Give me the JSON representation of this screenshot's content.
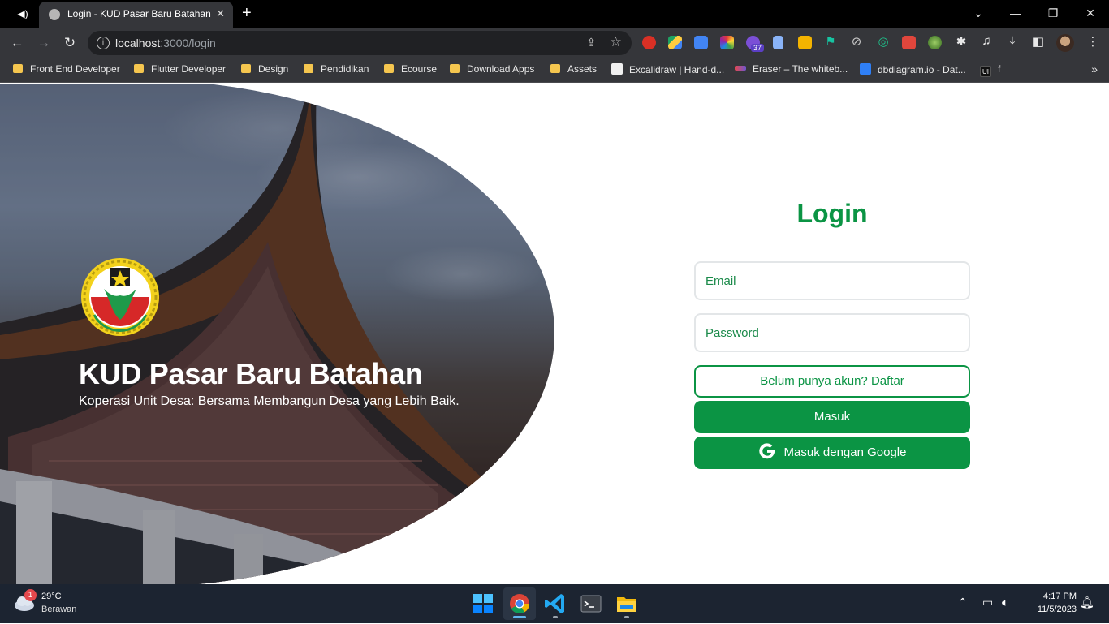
{
  "browser": {
    "tab_title": "Login - KUD Pasar Baru Batahan",
    "url_host": "localhost",
    "url_path": ":3000/login",
    "extension_badge": "37",
    "bookmarks": [
      {
        "label": "Front End Developer",
        "type": "folder"
      },
      {
        "label": "Flutter Developer",
        "type": "folder"
      },
      {
        "label": "Design",
        "type": "folder"
      },
      {
        "label": "Pendidikan",
        "type": "folder"
      },
      {
        "label": "Ecourse",
        "type": "folder"
      },
      {
        "label": "Download Apps",
        "type": "folder"
      },
      {
        "label": "Assets",
        "type": "folder"
      },
      {
        "label": "Excalidraw | Hand-d...",
        "type": "site"
      },
      {
        "label": "Eraser – The whiteb...",
        "type": "site"
      },
      {
        "label": "dbdiagram.io - Dat...",
        "type": "site"
      },
      {
        "label": "f",
        "type": "site"
      }
    ],
    "bookmark_ui_icon_text": "UI"
  },
  "hero": {
    "title": "KUD Pasar Baru Batahan",
    "subtitle": "Koperasi Unit Desa: Bersama Membangun Desa yang Lebih Baik.",
    "logo_caption": "KOPERASI INDONESIA"
  },
  "login": {
    "title": "Login",
    "email_placeholder": "Email",
    "password_placeholder": "Password",
    "register_label": "Belum punya akun? Daftar",
    "submit_label": "Masuk",
    "google_label": "Masuk dengan Google"
  },
  "taskbar": {
    "weather_badge": "1",
    "temperature": "29°C",
    "weather_desc": "Berawan",
    "time": "4:17 PM",
    "date": "11/5/2023"
  },
  "colors": {
    "brand_green": "#0b9444",
    "chrome_dark": "#35363a",
    "taskbar": "#1c2431"
  }
}
